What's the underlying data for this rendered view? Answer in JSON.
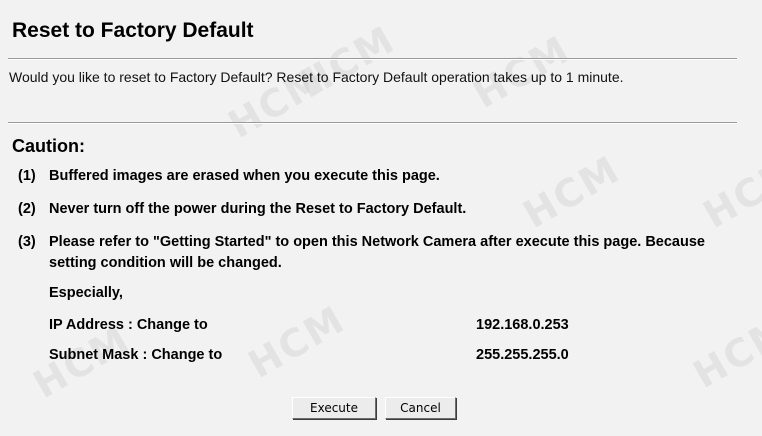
{
  "header": {
    "title": "Reset to Factory Default"
  },
  "description": "Would you like to reset to Factory Default? Reset to Factory Default operation takes up to 1 minute.",
  "caution": {
    "heading": "Caution:",
    "items": [
      {
        "num": "(1)",
        "text": "Buffered images are erased when you execute this page."
      },
      {
        "num": "(2)",
        "text": "Never turn off the power during the Reset to Factory Default."
      },
      {
        "num": "(3)",
        "text": "Please refer to \"Getting Started\" to open this Network Camera after execute this page. Because setting condition will be changed."
      }
    ],
    "especially": "Especially,",
    "settings": [
      {
        "label": "IP Address : Change to",
        "value": "192.168.0.253"
      },
      {
        "label": "Subnet Mask : Change to",
        "value": "255.255.255.0"
      }
    ]
  },
  "buttons": {
    "execute": "Execute",
    "cancel": "Cancel"
  },
  "watermark": {
    "text": "HCM"
  }
}
